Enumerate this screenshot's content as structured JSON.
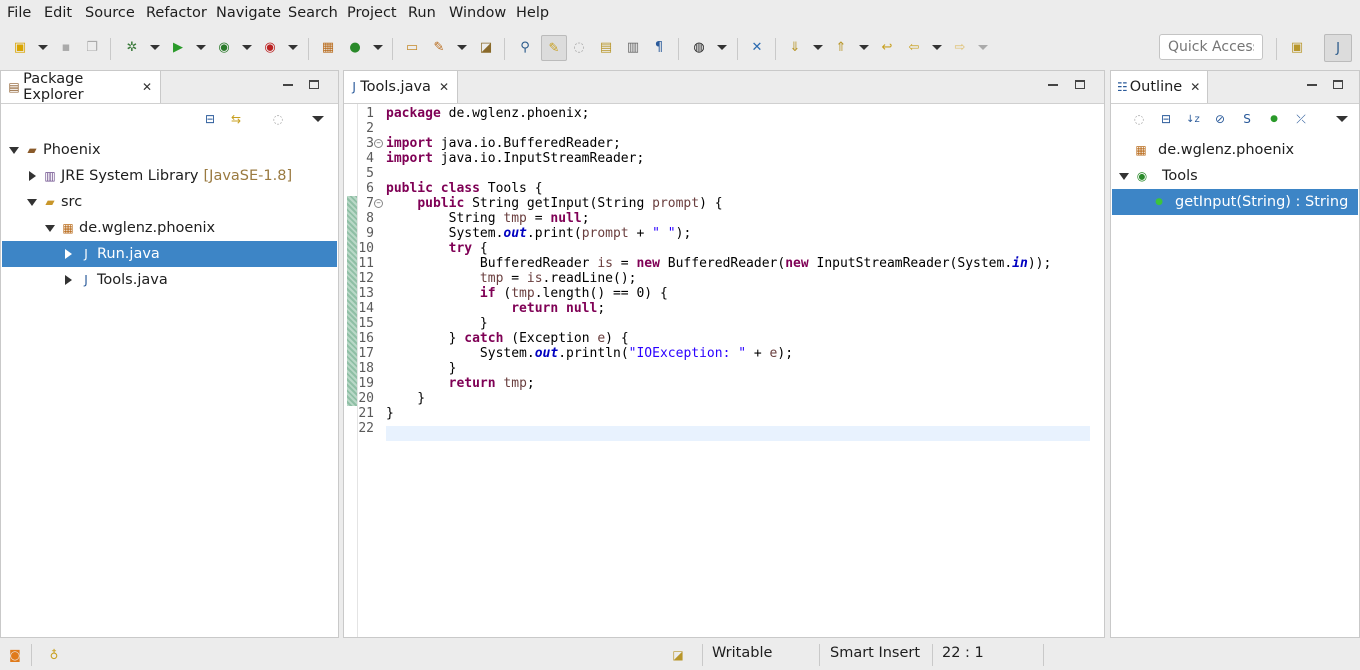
{
  "menu": [
    "File",
    "Edit",
    "Source",
    "Refactor",
    "Navigate",
    "Search",
    "Project",
    "Run",
    "Window",
    "Help"
  ],
  "quick_access": {
    "placeholder": "Quick Access"
  },
  "package_explorer": {
    "title": "Package Explorer",
    "tree": [
      {
        "label": "Phoenix",
        "icon": "project-icon"
      },
      {
        "label": "JRE System Library",
        "suffix": "[JavaSE-1.8]",
        "icon": "library-icon"
      },
      {
        "label": "src",
        "icon": "source-folder-icon"
      },
      {
        "label": "de.wglenz.phoenix",
        "icon": "package-icon"
      },
      {
        "label": "Run.java",
        "icon": "java-file-icon"
      },
      {
        "label": "Tools.java",
        "icon": "java-file-icon"
      }
    ]
  },
  "editor": {
    "tab_label": "Tools.java",
    "lines": [
      "package de.wglenz.phoenix;",
      "",
      "import java.io.BufferedReader;",
      "import java.io.InputStreamReader;",
      "",
      "public class Tools {",
      "    public String getInput(String prompt) {",
      "        String tmp = null;",
      "        System.out.print(prompt + \" \");",
      "        try {",
      "            BufferedReader is = new BufferedReader(new InputStreamReader(System.in));",
      "            tmp = is.readLine();",
      "            if (tmp.length() == 0) {",
      "                return null;",
      "            }",
      "        } catch (Exception e) {",
      "            System.out.println(\"IOException: \" + e);",
      "        }",
      "        return tmp;",
      "    }",
      "}",
      ""
    ]
  },
  "outline": {
    "title": "Outline",
    "items": [
      {
        "label": "de.wglenz.phoenix",
        "icon": "package-icon"
      },
      {
        "label": "Tools",
        "icon": "class-icon"
      },
      {
        "label": "getInput(String) : String",
        "icon": "public-method-icon"
      }
    ]
  },
  "status": {
    "writable": "Writable",
    "insert_mode": "Smart Insert",
    "position": "22 : 1"
  },
  "colors": {
    "selection": "#3d85c6",
    "keyword": "#7f0055",
    "string": "#2a00ff",
    "current_line": "#e8f2fe"
  }
}
